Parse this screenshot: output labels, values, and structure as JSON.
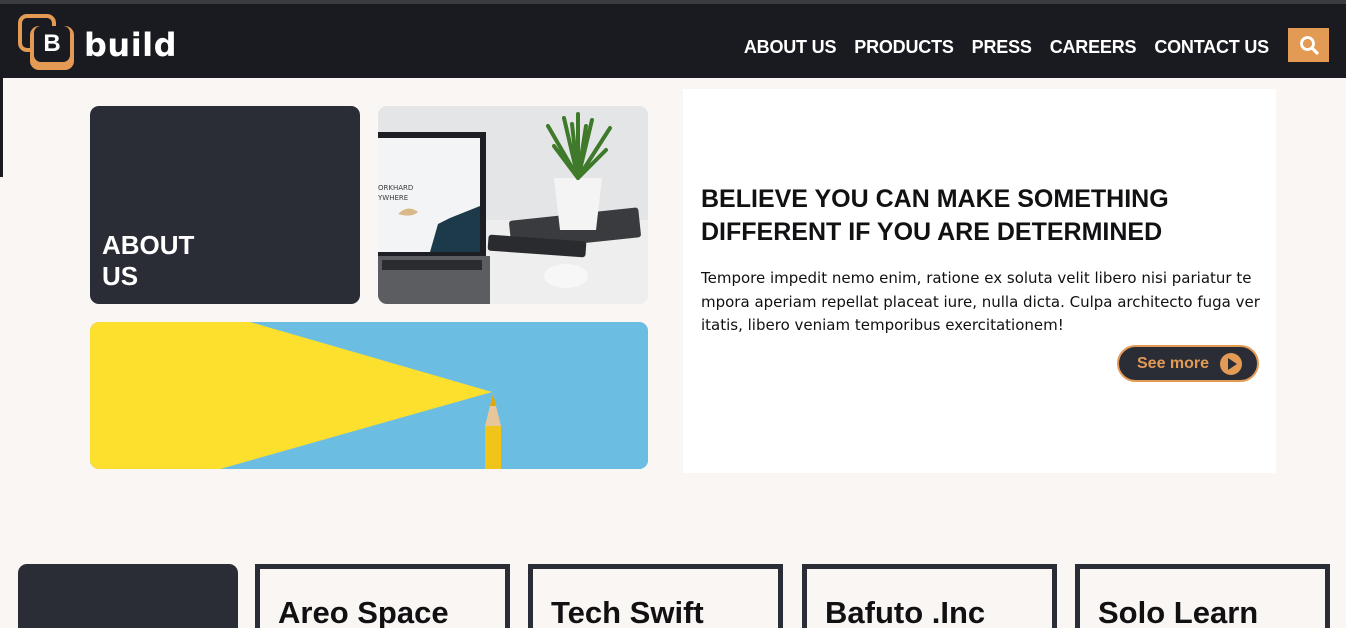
{
  "brand": {
    "logo_letter": "B",
    "name": "build",
    "accent": "#e39a55",
    "dark": "#1a1b20"
  },
  "nav": {
    "items": [
      {
        "label": "ABOUT US"
      },
      {
        "label": "PRODUCTS"
      },
      {
        "label": "PRESS"
      },
      {
        "label": "CAREERS"
      },
      {
        "label": "CONTACT US"
      }
    ],
    "search_icon": "search-icon"
  },
  "about": {
    "title": "ABOUT US"
  },
  "images": {
    "laptop_screen_text_1": "ORKHARD",
    "laptop_screen_text_2": "YWHERE"
  },
  "hero": {
    "heading": "BELIEVE YOU CAN MAKE SOMETHING DIFFERENT IF YOU ARE DETERMINED",
    "body": "Tempore impedit nemo enim, ratione ex soluta velit libero nisi pariatur tempora aperiam repellat placeat iure, nulla dicta. Culpa architecto fuga veritatis, libero veniam temporibus exercitationem!",
    "cta_label": "See more",
    "cta_icon": "play-circle-icon"
  },
  "companies": [
    {
      "name": "Areo Space"
    },
    {
      "name": "Tech Swift"
    },
    {
      "name": "Bafuto .Inc"
    },
    {
      "name": "Solo Learn"
    }
  ]
}
